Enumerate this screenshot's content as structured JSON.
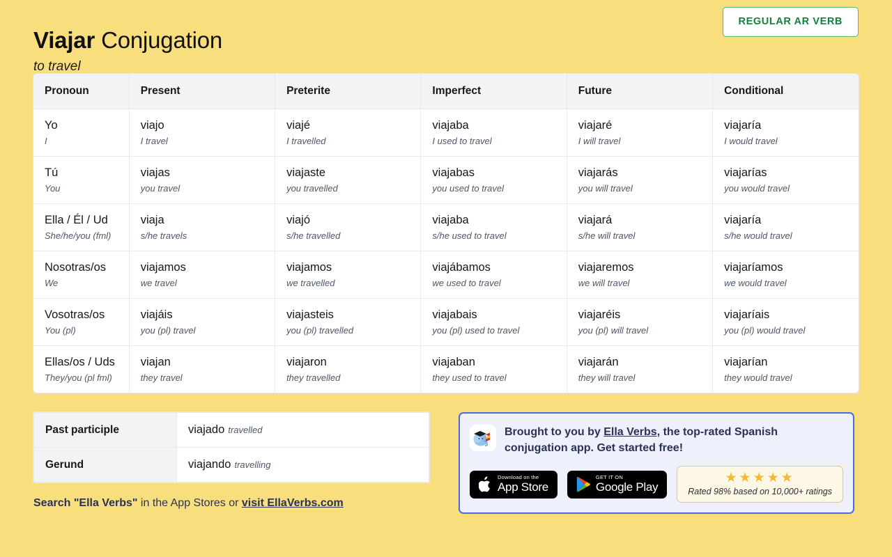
{
  "header": {
    "verb": "Viajar",
    "title_rest": " Conjugation",
    "translation": "to travel",
    "badge": "REGULAR AR VERB"
  },
  "table": {
    "columns": [
      "Pronoun",
      "Present",
      "Preterite",
      "Imperfect",
      "Future",
      "Conditional"
    ],
    "rows": [
      {
        "pronoun": "Yo",
        "pronoun_translation": "I",
        "cells": [
          {
            "form": "viajo",
            "translation": "I travel"
          },
          {
            "form": "viajé",
            "translation": "I travelled"
          },
          {
            "form": "viajaba",
            "translation": "I used to travel"
          },
          {
            "form": "viajaré",
            "translation": "I will travel"
          },
          {
            "form": "viajaría",
            "translation": "I would travel"
          }
        ]
      },
      {
        "pronoun": "Tú",
        "pronoun_translation": "You",
        "cells": [
          {
            "form": "viajas",
            "translation": "you travel"
          },
          {
            "form": "viajaste",
            "translation": "you travelled"
          },
          {
            "form": "viajabas",
            "translation": "you used to travel"
          },
          {
            "form": "viajarás",
            "translation": "you will travel"
          },
          {
            "form": "viajarías",
            "translation": "you would travel"
          }
        ]
      },
      {
        "pronoun": "Ella / Él / Ud",
        "pronoun_translation": "She/he/you (fml)",
        "cells": [
          {
            "form": "viaja",
            "translation": "s/he travels"
          },
          {
            "form": "viajó",
            "translation": "s/he travelled"
          },
          {
            "form": "viajaba",
            "translation": "s/he used to travel"
          },
          {
            "form": "viajará",
            "translation": "s/he will travel"
          },
          {
            "form": "viajaría",
            "translation": "s/he would travel"
          }
        ]
      },
      {
        "pronoun": "Nosotras/os",
        "pronoun_translation": "We",
        "cells": [
          {
            "form": "viajamos",
            "translation": "we travel"
          },
          {
            "form": "viajamos",
            "translation": "we travelled"
          },
          {
            "form": "viajábamos",
            "translation": "we used to travel"
          },
          {
            "form": "viajaremos",
            "translation": "we will travel"
          },
          {
            "form": "viajaríamos",
            "translation": "we would travel"
          }
        ]
      },
      {
        "pronoun": "Vosotras/os",
        "pronoun_translation": "You (pl)",
        "cells": [
          {
            "form": "viajáis",
            "translation": "you (pl) travel"
          },
          {
            "form": "viajasteis",
            "translation": "you (pl) travelled"
          },
          {
            "form": "viajabais",
            "translation": "you (pl) used to travel"
          },
          {
            "form": "viajaréis",
            "translation": "you (pl) will travel"
          },
          {
            "form": "viajaríais",
            "translation": "you (pl) would travel"
          }
        ]
      },
      {
        "pronoun": "Ellas/os / Uds",
        "pronoun_translation": "They/you (pl fml)",
        "cells": [
          {
            "form": "viajan",
            "translation": "they travel"
          },
          {
            "form": "viajaron",
            "translation": "they travelled"
          },
          {
            "form": "viajaban",
            "translation": "they used to travel"
          },
          {
            "form": "viajarán",
            "translation": "they will travel"
          },
          {
            "form": "viajarían",
            "translation": "they would travel"
          }
        ]
      }
    ]
  },
  "extra": {
    "rows": [
      {
        "label": "Past participle",
        "form": "viajado",
        "translation": "travelled"
      },
      {
        "label": "Gerund",
        "form": "viajando",
        "translation": "travelling"
      }
    ]
  },
  "search_line": {
    "part1": "Search \"Ella Verbs\"",
    "part2": " in the App Stores or ",
    "link": "visit EllaVerbs.com"
  },
  "promo": {
    "text_before": "Brought to you by ",
    "link": "Ella Verbs",
    "text_after": ", the top-rated Spanish conjugation app. Get started free!",
    "app_store": {
      "small": "Download on the",
      "big": "App Store"
    },
    "google_play": {
      "small": "GET IT ON",
      "big": "Google Play"
    },
    "rating": {
      "stars": "★★★★★",
      "text": "Rated 98% based on 10,000+ ratings"
    }
  },
  "colors": {
    "background": "#f9de7e",
    "badge_green": "#14803c",
    "promo_border": "#4f6ae0",
    "promo_bg": "#eef0fc",
    "navy_text": "#2a3356",
    "star_gold": "#f5b82e"
  }
}
